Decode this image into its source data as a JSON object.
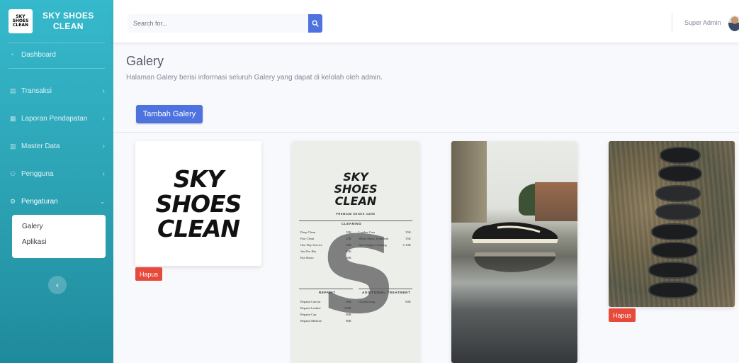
{
  "brand": {
    "logo_lines": [
      "SKY",
      "SHOES",
      "CLEAN"
    ],
    "name_line1": "SKY SHOES",
    "name_line2": "CLEAN"
  },
  "sidebar": {
    "items": [
      {
        "label": "Dashboard",
        "icon": "dashboard-icon",
        "has_chevron": false
      },
      {
        "label": "Transaksi",
        "icon": "cart-icon",
        "has_chevron": true
      },
      {
        "label": "Laporan Pendapatan",
        "icon": "report-icon",
        "has_chevron": true
      },
      {
        "label": "Master Data",
        "icon": "database-icon",
        "has_chevron": true
      },
      {
        "label": "Pengguna",
        "icon": "users-icon",
        "has_chevron": true
      },
      {
        "label": "Pengaturan",
        "icon": "cog-icon",
        "has_chevron": true,
        "expanded": true
      }
    ],
    "submenu": [
      "Galery",
      "Aplikasi"
    ],
    "toggle_icon": "chevron-left-icon"
  },
  "topbar": {
    "search_placeholder": "Search for...",
    "search_icon": "search-icon",
    "user_name": "Super Admin"
  },
  "page": {
    "title": "Galery",
    "description": "Halaman Galery berisi informasi seluruh Galery yang dapat di kelolah oleh admin.",
    "add_button": "Tambah Galery"
  },
  "gallery": {
    "delete_label": "Hapus",
    "cards": [
      {
        "image": "sky-shoes-clean-logo"
      },
      {
        "image": "price-list-flyer"
      },
      {
        "image": "sneaker-on-wet-road-photo"
      },
      {
        "image": "shoes-top-view-photo"
      }
    ]
  },
  "pricelist": {
    "title_lines": [
      "SKY",
      "SHOES",
      "CLEAN"
    ],
    "subtitle": "PREMIUM SHOES CARE",
    "section_cleaning": "CLEANING",
    "section_repaint": "REPAINT",
    "section_additional": "ADDITIONAL TREATMENT",
    "left_rows": [
      {
        "name": "Deep Clean",
        "price": "35K"
      },
      {
        "name": "Fast Clean",
        "price": "25K"
      },
      {
        "name": "One Day Service",
        "price": "50K"
      },
      {
        "name": "Just For Her",
        "price": "35K"
      },
      {
        "name": "Kid Shoes",
        "price": "30K"
      }
    ],
    "right_rows": [
      {
        "name": "Leather Care",
        "price": "35K"
      },
      {
        "name": "White Shoes Treatment",
        "price": "35K"
      },
      {
        "name": "Anti Fungus Cleaning",
        "price": "5-10K"
      }
    ],
    "repaint_rows": [
      {
        "name": "Repaint Canvas",
        "price": "90K"
      },
      {
        "name": "Repaint Leather",
        "price": "120K"
      },
      {
        "name": "Repaint Cap",
        "price": "80K"
      },
      {
        "name": "Repaint Midsole",
        "price": "80K"
      }
    ],
    "additional_rows": [
      {
        "name": "Unyellowing",
        "price": "60K"
      }
    ]
  },
  "colors": {
    "sidebar": "#36b9cc",
    "primary": "#4e73df",
    "danger": "#e74a3b",
    "background": "#f8f9fc"
  }
}
